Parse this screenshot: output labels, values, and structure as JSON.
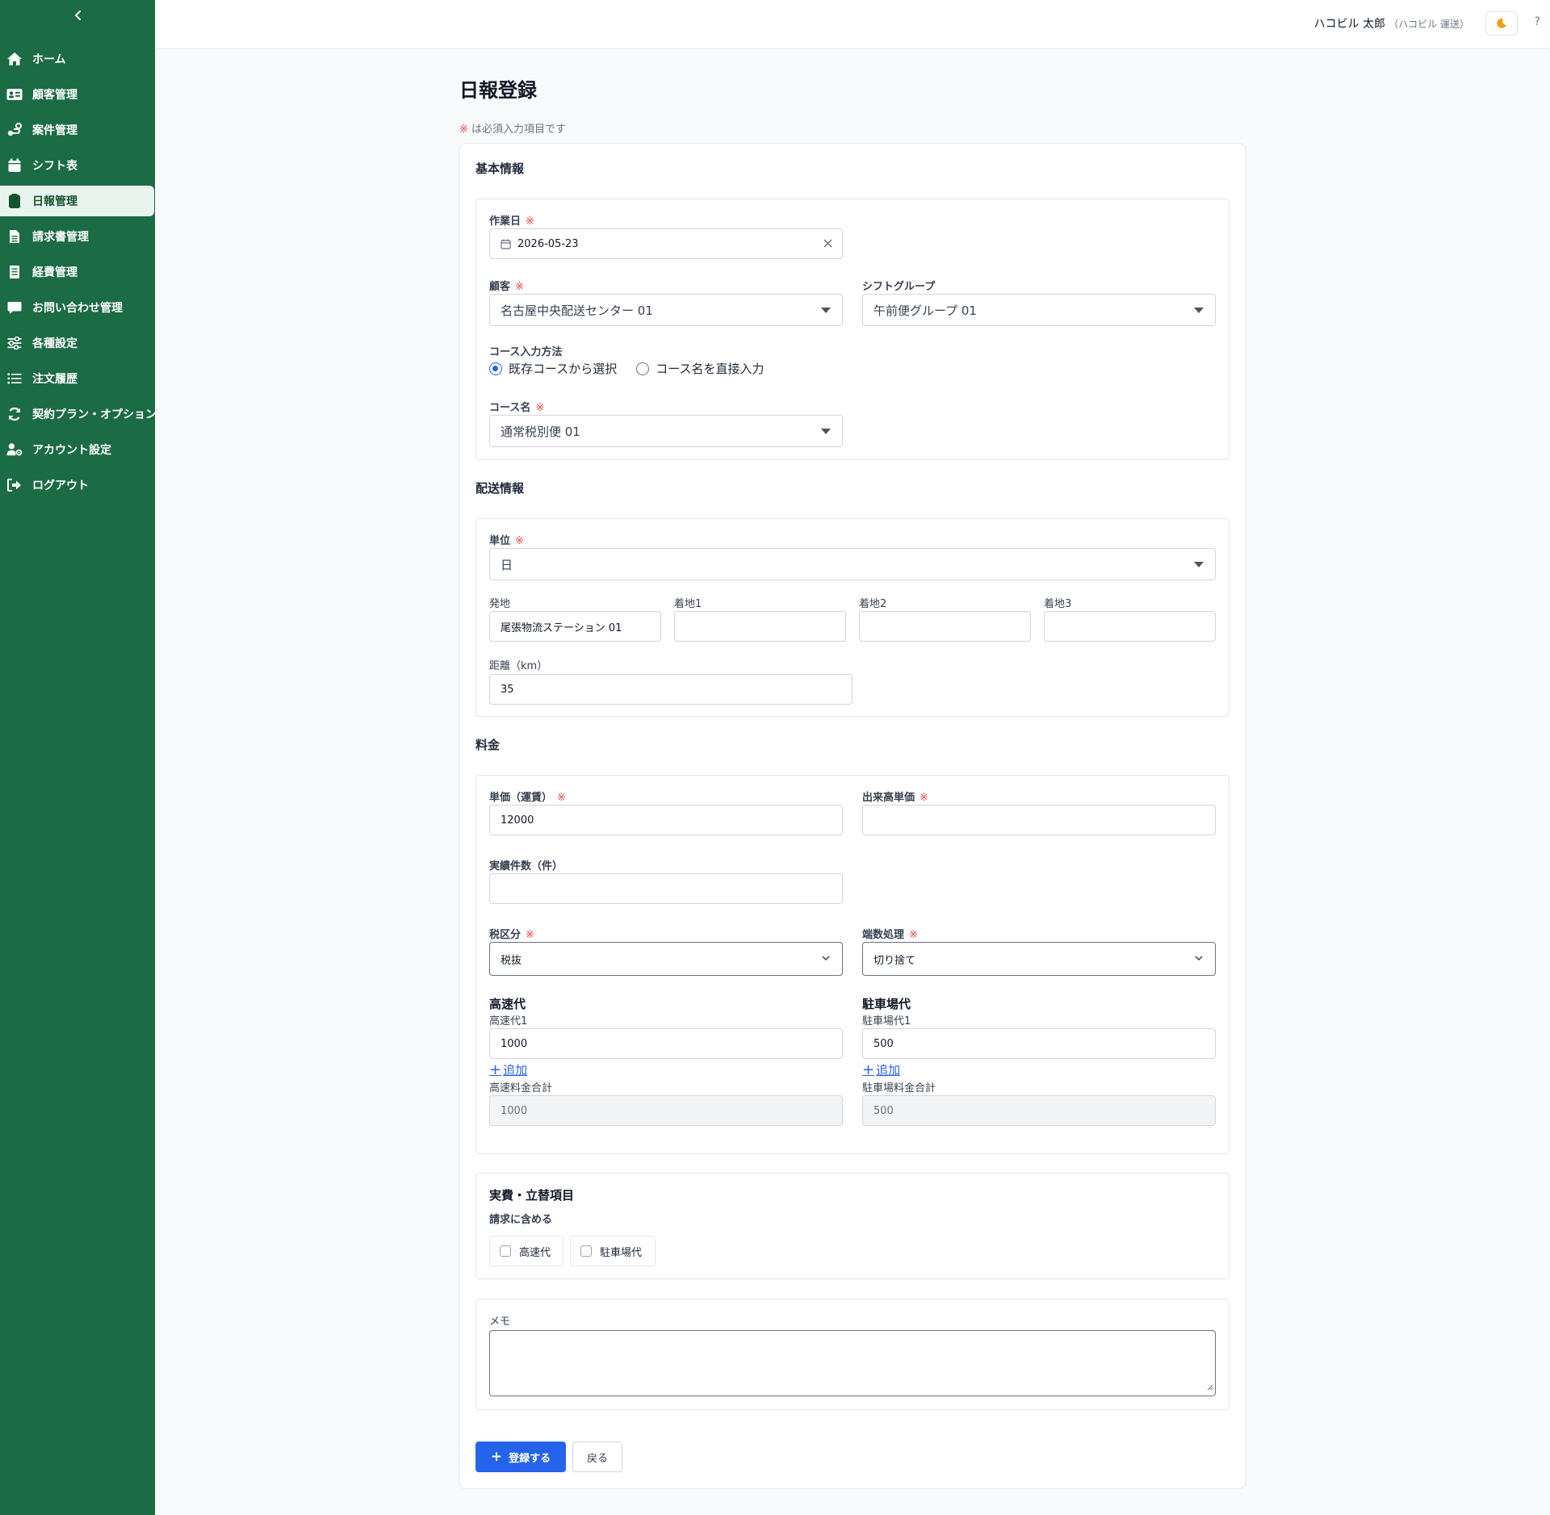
{
  "sidebar": {
    "items": [
      {
        "label": "ホーム",
        "icon": "home-icon"
      },
      {
        "label": "顧客管理",
        "icon": "id-card-icon"
      },
      {
        "label": "案件管理",
        "icon": "route-icon"
      },
      {
        "label": "シフト表",
        "icon": "calendar-icon"
      },
      {
        "label": "日報管理",
        "icon": "clipboard-icon",
        "active": true
      },
      {
        "label": "請求書管理",
        "icon": "invoice-icon"
      },
      {
        "label": "経費管理",
        "icon": "receipt-icon"
      },
      {
        "label": "お問い合わせ管理",
        "icon": "chat-icon"
      },
      {
        "label": "各種設定",
        "icon": "sliders-icon"
      },
      {
        "label": "注文履歴",
        "icon": "list-icon"
      },
      {
        "label": "契約プラン・オプション",
        "icon": "refresh-icon"
      },
      {
        "label": "アカウント設定",
        "icon": "user-gear-icon"
      },
      {
        "label": "ログアウト",
        "icon": "logout-icon"
      }
    ]
  },
  "header": {
    "user_name": "ハコビル 太郎",
    "user_org": "（ハコビル 運送）",
    "help": "?",
    "theme_icon": "moon-icon"
  },
  "page": {
    "title": "日報登録",
    "required_mark": "※",
    "required_note": " は必須入力項目です"
  },
  "basic": {
    "title": "基本情報",
    "work_date_label": "作業日",
    "work_date_value": "2026-05-23",
    "customer_label": "顧客",
    "customer_value": "名古屋中央配送センター 01",
    "shift_group_label": "シフトグループ",
    "shift_group_value": "午前便グループ 01",
    "course_method_label": "コース入力方法",
    "course_method_options": [
      "既存コースから選択",
      "コース名を直接入力"
    ],
    "course_name_label": "コース名",
    "course_name_value": "通常税別便 01"
  },
  "delivery": {
    "title": "配送情報",
    "unit_label": "単位",
    "unit_value": "日",
    "origin_label": "発地",
    "origin_value": "尾張物流ステーション 01",
    "dest1_label": "着地1",
    "dest2_label": "着地2",
    "dest3_label": "着地3",
    "distance_label": "距離（km）",
    "distance_value": "35"
  },
  "fee": {
    "title": "料金",
    "unit_price_label": "単価（運賃）",
    "unit_price_value": "12000",
    "output_price_label": "出来高単価",
    "output_price_value": "",
    "actual_count_label": "実績件数（件）",
    "actual_count_value": "",
    "tax_label": "税区分",
    "tax_value": "税抜",
    "rounding_label": "端数処理",
    "rounding_value": "切り捨て",
    "highway_title": "高速代",
    "highway1_label": "高速代1",
    "highway1_value": "1000",
    "highway_total_label": "高速料金合計",
    "highway_total_value": "1000",
    "parking_title": "駐車場代",
    "parking1_label": "駐車場代1",
    "parking1_value": "500",
    "parking_total_label": "駐車場料金合計",
    "parking_total_value": "500",
    "add_label": "追加",
    "plus": "+"
  },
  "expense": {
    "title": "実費・立替項目",
    "include_label": "請求に含める",
    "options": [
      "高速代",
      "駐車場代"
    ]
  },
  "memo": {
    "label": "メモ",
    "value": ""
  },
  "actions": {
    "submit_plus": "+",
    "submit_label": "登録する",
    "back_label": "戻る"
  },
  "colors": {
    "sidebar_bg": "#1b6b45",
    "primary": "#2563eb",
    "required": "#ef4444"
  }
}
